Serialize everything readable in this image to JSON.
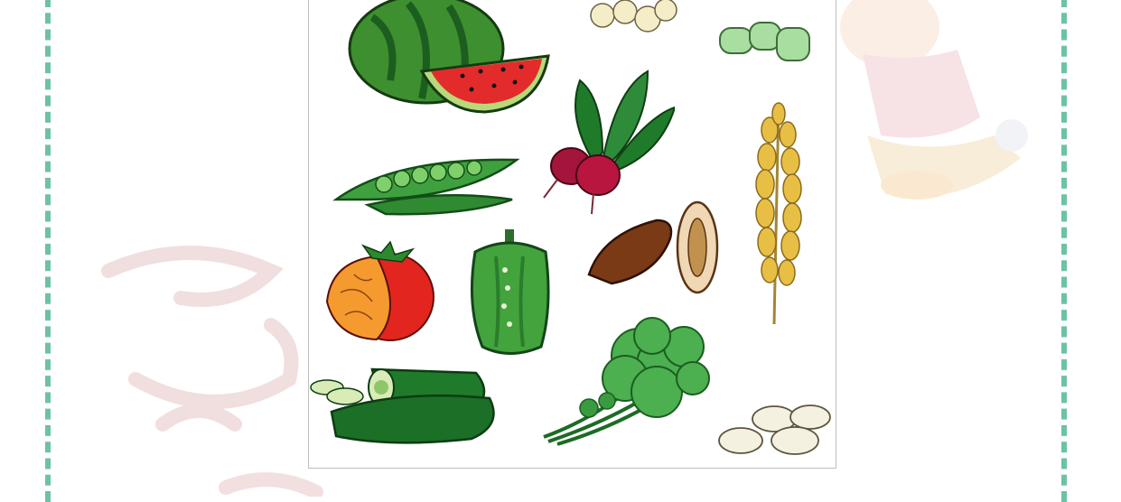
{
  "colors": {
    "page_background": "#ffffff",
    "border_accent": "#6cc3a3",
    "frame_border": "#bdbdbd",
    "watermark": "#e6c7c7"
  },
  "illustration": {
    "items": [
      "watermelon-icon",
      "chickpeas-icon",
      "fava-beans-icon",
      "radish-icon",
      "wheat-icon",
      "peas-icon",
      "date-icon",
      "tomato-icon",
      "bell-pepper-icon",
      "cucumber-icon",
      "parsley-icon",
      "white-beans-icon"
    ]
  }
}
